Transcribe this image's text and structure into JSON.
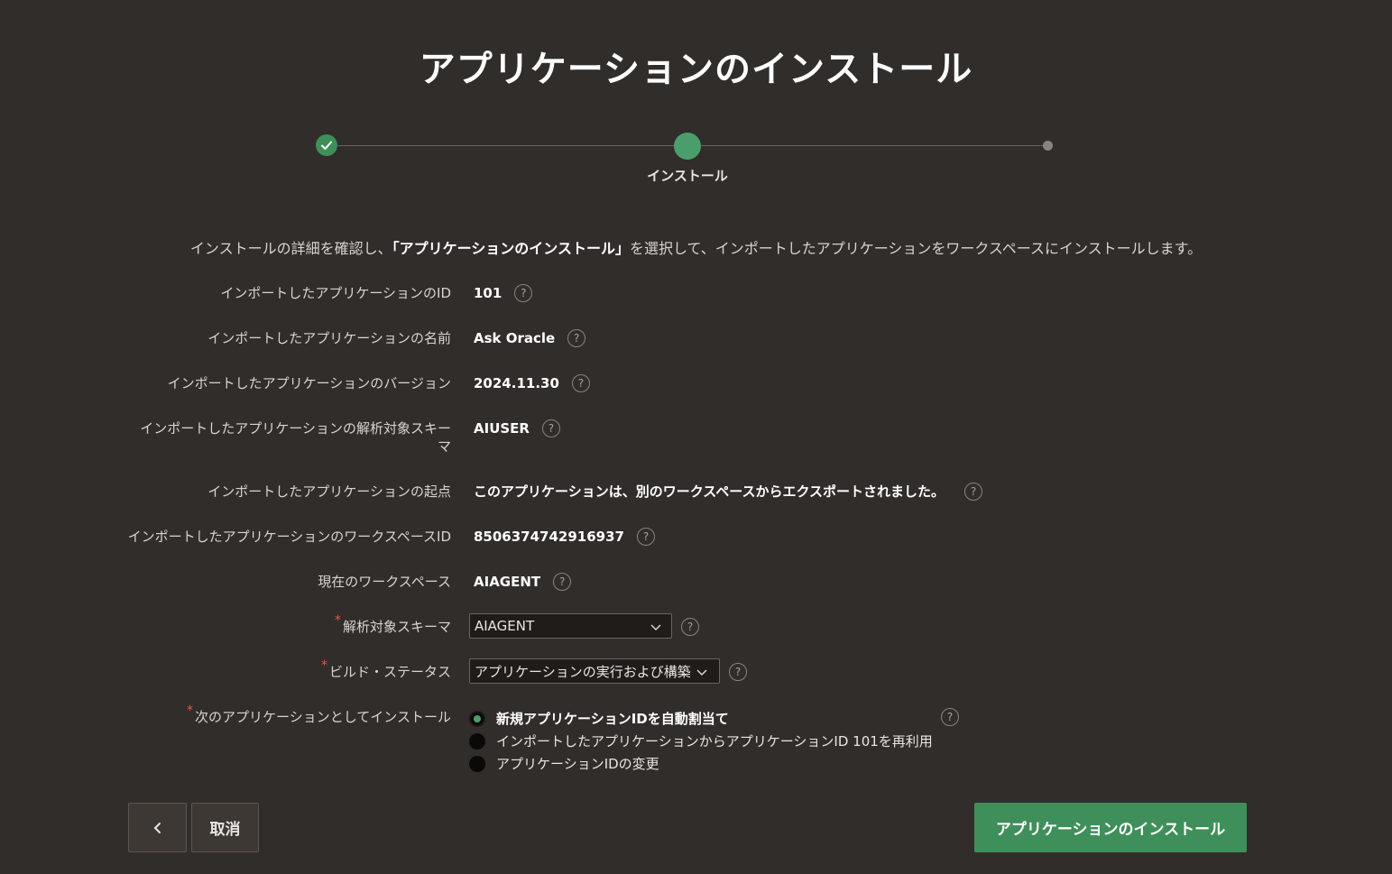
{
  "title": "アプリケーションのインストール",
  "wizard": {
    "current_step_label": "インストール"
  },
  "instruction": {
    "before": "インストールの詳細を確認し、",
    "bold": "「アプリケーションのインストール」",
    "after": "を選択して、インポートしたアプリケーションをワークスペースにインストールします。"
  },
  "fields": {
    "app_id": {
      "label": "インポートしたアプリケーションのID",
      "value": "101"
    },
    "app_name": {
      "label": "インポートしたアプリケーションの名前",
      "value": "Ask Oracle"
    },
    "app_version": {
      "label": "インポートしたアプリケーションのバージョン",
      "value": "2024.11.30"
    },
    "parsing_schema_src": {
      "label": "インポートしたアプリケーションの解析対象スキーマ",
      "value": "AIUSER"
    },
    "origin": {
      "label": "インポートしたアプリケーションの起点",
      "value": "このアプリケーションは、別のワークスペースからエクスポートされました。"
    },
    "workspace_id": {
      "label": "インポートしたアプリケーションのワークスペースID",
      "value": "8506374742916937"
    },
    "current_workspace": {
      "label": "現在のワークスペース",
      "value": "AIAGENT"
    },
    "parsing_schema": {
      "label": "解析対象スキーマ",
      "value": "AIAGENT"
    },
    "build_status": {
      "label": "ビルド・ステータス",
      "value": "アプリケーションの実行および構築"
    },
    "install_as": {
      "label": "次のアプリケーションとしてインストール",
      "options": [
        "新規アプリケーションIDを自動割当て",
        "インポートしたアプリケーションからアプリケーションID 101を再利用",
        "アプリケーションIDの変更"
      ],
      "selected": "新規アプリケーションIDを自動割当て"
    }
  },
  "help_glyph": "?",
  "required_mark": "*",
  "buttons": {
    "back": "‹",
    "cancel": "取消",
    "install": "アプリケーションのインストール"
  },
  "colors": {
    "background": "#312d2a",
    "accent": "#3f8f5a",
    "required": "#e35b4f"
  }
}
